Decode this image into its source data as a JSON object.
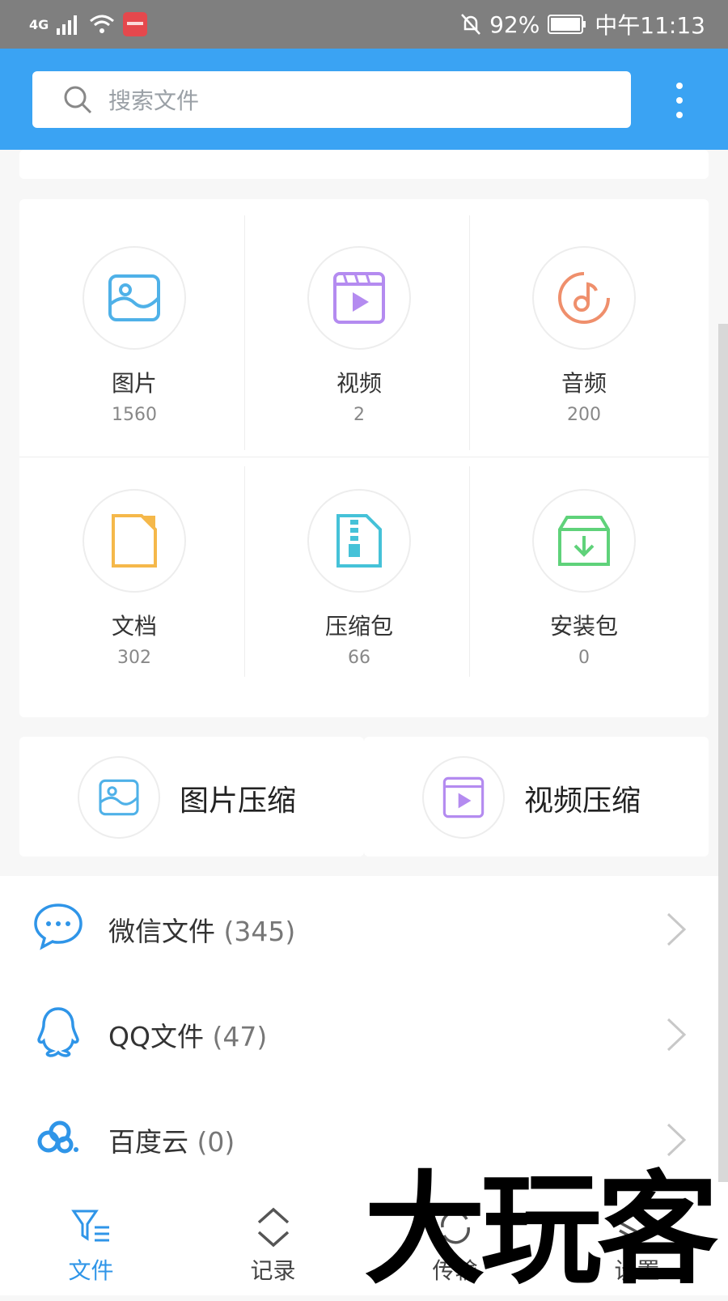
{
  "status_bar": {
    "network": "4G",
    "battery": "92%",
    "time": "中午11:13"
  },
  "search": {
    "placeholder": "搜索文件"
  },
  "categories": [
    {
      "label": "图片",
      "count": "1560",
      "icon": "image-icon",
      "color": "#4fb1e8"
    },
    {
      "label": "视频",
      "count": "2",
      "icon": "video-icon",
      "color": "#b48bf0"
    },
    {
      "label": "音频",
      "count": "200",
      "icon": "music-disc-icon",
      "color": "#ef8f6c"
    },
    {
      "label": "文档",
      "count": "302",
      "icon": "document-icon",
      "color": "#f5b84a"
    },
    {
      "label": "压缩包",
      "count": "66",
      "icon": "zip-icon",
      "color": "#45c2d8"
    },
    {
      "label": "安装包",
      "count": "0",
      "icon": "package-icon",
      "color": "#5fd27a"
    }
  ],
  "compress": [
    {
      "label": "图片压缩",
      "icon": "image-icon"
    },
    {
      "label": "视频压缩",
      "icon": "video-icon"
    }
  ],
  "sources": [
    {
      "name": "微信文件",
      "count": "(345)",
      "icon": "wechat-icon"
    },
    {
      "name": "QQ文件",
      "count": "(47)",
      "icon": "qq-icon"
    },
    {
      "name": "百度云",
      "count": "(0)",
      "icon": "baidu-cloud-icon"
    }
  ],
  "nav": [
    {
      "label": "文件",
      "icon": "files-filter-icon",
      "active": true
    },
    {
      "label": "记录",
      "icon": "updown-chevron-icon"
    },
    {
      "label": "传输",
      "icon": "sync-icon"
    },
    {
      "label": "设置",
      "icon": "layers-icon"
    }
  ],
  "watermark": "大玩客"
}
